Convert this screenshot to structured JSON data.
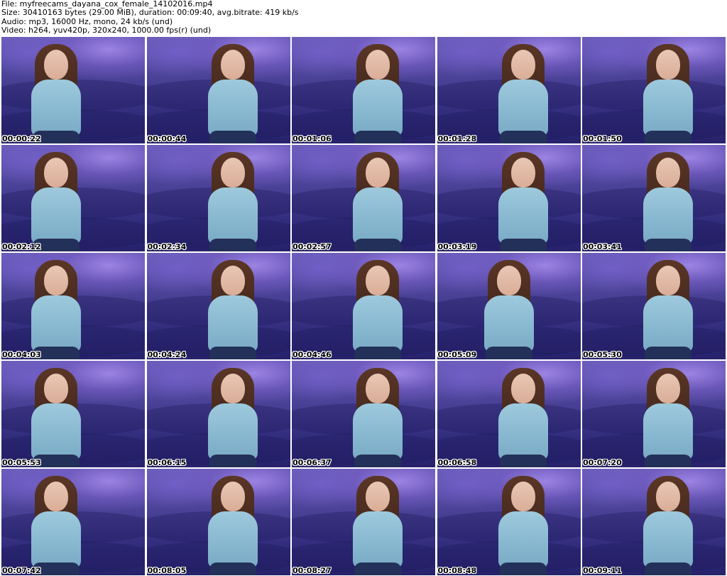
{
  "header": {
    "file_line": "File: myfreecams_dayana_cox_female_14102016.mp4",
    "size_line": "Size: 30410163 bytes (29.00 MiB), duration: 00:09:40, avg.bitrate: 419 kb/s",
    "audio_line": "Audio: mp3, 16000 Hz, mono, 24 kb/s (und)",
    "video_line": "Video: h264, yuv420p, 320x240, 1000.00 fps(r) (und)"
  },
  "thumbnails": [
    {
      "timestamp": "00:00:22"
    },
    {
      "timestamp": "00:00:44"
    },
    {
      "timestamp": "00:01:06"
    },
    {
      "timestamp": "00:01:28"
    },
    {
      "timestamp": "00:01:50"
    },
    {
      "timestamp": "00:02:12"
    },
    {
      "timestamp": "00:02:34"
    },
    {
      "timestamp": "00:02:57"
    },
    {
      "timestamp": "00:03:19"
    },
    {
      "timestamp": "00:03:41"
    },
    {
      "timestamp": "00:04:03"
    },
    {
      "timestamp": "00:04:24"
    },
    {
      "timestamp": "00:04:46"
    },
    {
      "timestamp": "00:05:09"
    },
    {
      "timestamp": "00:05:30"
    },
    {
      "timestamp": "00:05:53"
    },
    {
      "timestamp": "00:06:15"
    },
    {
      "timestamp": "00:06:37"
    },
    {
      "timestamp": "00:06:58"
    },
    {
      "timestamp": "00:07:20"
    },
    {
      "timestamp": "00:07:42"
    },
    {
      "timestamp": "00:08:05"
    },
    {
      "timestamp": "00:08:27"
    },
    {
      "timestamp": "00:08:48"
    },
    {
      "timestamp": "00:09:11"
    }
  ],
  "colors": {
    "background": "#ffffff",
    "text": "#000000",
    "timestamp_outline": "#ffffff",
    "scene_backdrop": "#463e92",
    "sweater": "#9ec9dd",
    "hair": "#4a2c1f"
  }
}
